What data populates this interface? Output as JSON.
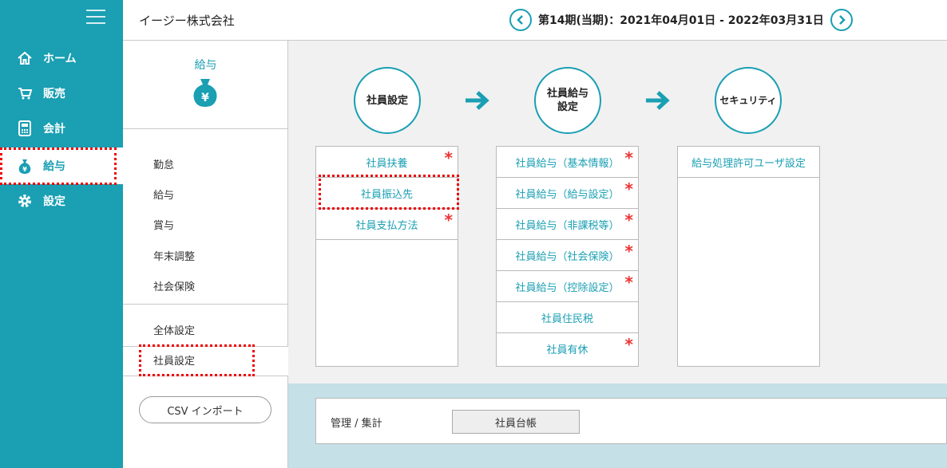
{
  "nav": {
    "items": [
      {
        "label": "ホーム",
        "icon": "home-icon"
      },
      {
        "label": "販売",
        "icon": "cart-icon"
      },
      {
        "label": "会計",
        "icon": "calculator-icon"
      },
      {
        "label": "給与",
        "icon": "money-bag-icon"
      },
      {
        "label": "設定",
        "icon": "gear-icon"
      }
    ],
    "active": "給与"
  },
  "header": {
    "company": "イージー株式会社",
    "period": "第14期(当期)：2021年04月01日 - 2022年03月31日"
  },
  "sub": {
    "title": "給与",
    "items": [
      "勤怠",
      "給与",
      "賞与",
      "年末調整",
      "社会保険",
      "全体設定",
      "社員設定"
    ],
    "active": "社員設定",
    "csv_button": "CSV インポート"
  },
  "steps": [
    {
      "label": "社員設定"
    },
    {
      "label": "社員給与\n設定"
    },
    {
      "label": "セキュリティ"
    }
  ],
  "panels": {
    "employee": [
      {
        "label": "社員扶養",
        "required": true
      },
      {
        "label": "社員振込先",
        "required": false
      },
      {
        "label": "社員支払方法",
        "required": true
      }
    ],
    "salary": [
      {
        "label": "社員給与（基本情報）",
        "required": true
      },
      {
        "label": "社員給与（給与設定）",
        "required": true
      },
      {
        "label": "社員給与（非課税等）",
        "required": true
      },
      {
        "label": "社員給与（社会保険）",
        "required": true
      },
      {
        "label": "社員給与（控除設定）",
        "required": true
      },
      {
        "label": "社員住民税",
        "required": false
      },
      {
        "label": "社員有休",
        "required": true
      }
    ],
    "security": [
      {
        "label": "給与処理許可ユーザ設定",
        "required": false
      }
    ]
  },
  "required_mark": "*",
  "management": {
    "label": "管理 / 集計",
    "button": "社員台帳"
  },
  "colors": {
    "accent": "#1a9fb3",
    "required": "#e33",
    "highlight": "#e00"
  }
}
